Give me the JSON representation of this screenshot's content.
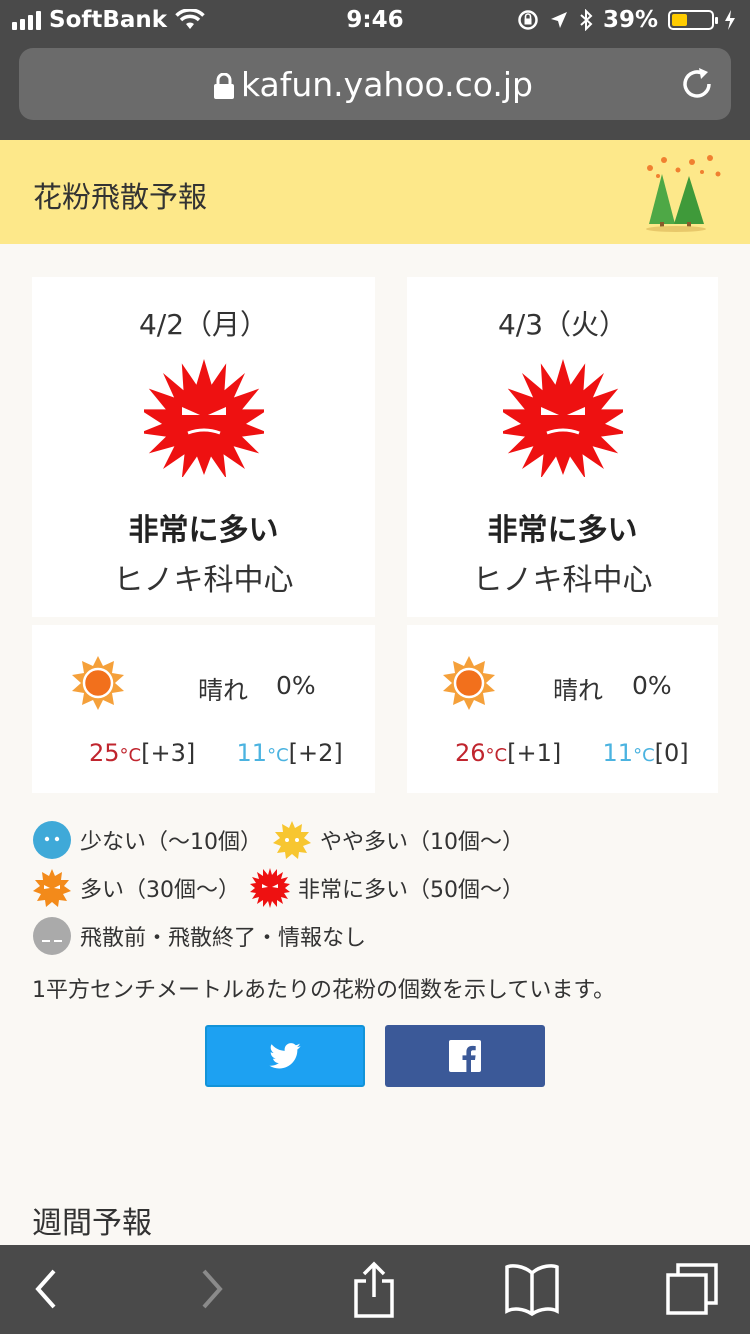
{
  "status_bar": {
    "carrier": "SoftBank",
    "time": "9:46",
    "battery_percent": "39%",
    "battery_level": 0.39
  },
  "browser": {
    "url": "kafun.yahoo.co.jp"
  },
  "page": {
    "title": "花粉飛散予報",
    "weekly_heading": "週間予報"
  },
  "forecast": [
    {
      "date": "4/2（月）",
      "level": "非常に多い",
      "species": "ヒノキ科中心",
      "weather": "晴れ",
      "precip": "0%",
      "temp_max": "25",
      "temp_max_diff": "[+3]",
      "temp_min": "11",
      "temp_min_diff": "[+2]",
      "unit": "°C"
    },
    {
      "date": "4/3（火）",
      "level": "非常に多い",
      "species": "ヒノキ科中心",
      "weather": "晴れ",
      "precip": "0%",
      "temp_max": "26",
      "temp_max_diff": "[+1]",
      "temp_min": "11",
      "temp_min_diff": "[0]",
      "unit": "°C"
    }
  ],
  "legend": {
    "low": "少ない（〜10個）",
    "moderate": "やや多い（10個〜）",
    "high": "多い（30個〜）",
    "very_high": "非常に多い（50個〜）",
    "none": "飛散前・飛散終了・情報なし",
    "note": "1平方センチメートルあたりの花粉の個数を示しています。"
  },
  "colors": {
    "very_high": "#ee1111",
    "high": "#f38a1a",
    "moderate": "#f7c630",
    "low": "#3fa9d8",
    "none": "#aaaaaa",
    "twitter": "#1da1f2",
    "facebook": "#3b5998"
  },
  "icons": [
    "lock-icon",
    "reload-icon",
    "trees-icon",
    "pollen-very-high-icon",
    "sun-icon",
    "twitter-icon",
    "facebook-icon",
    "back-icon",
    "forward-icon",
    "share-icon",
    "bookmarks-icon",
    "tabs-icon"
  ]
}
